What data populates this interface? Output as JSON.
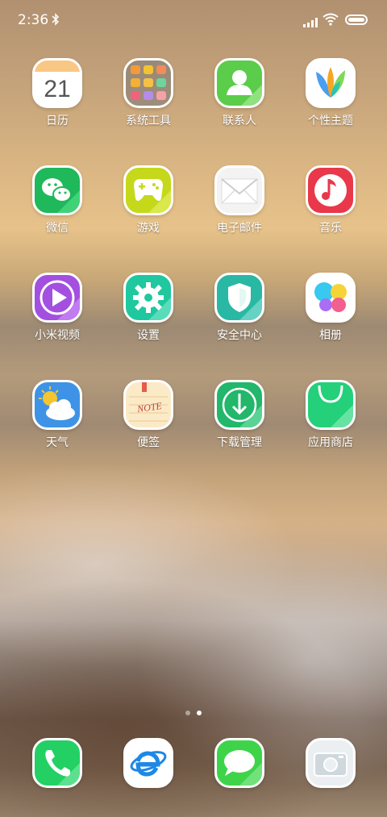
{
  "status": {
    "time": "2:36"
  },
  "grid": [
    {
      "label": "日历",
      "icon": "calendar-icon",
      "badge": "21"
    },
    {
      "label": "系统工具",
      "icon": "system-tools-folder-icon"
    },
    {
      "label": "联系人",
      "icon": "contacts-icon"
    },
    {
      "label": "个性主题",
      "icon": "themes-icon"
    },
    {
      "label": "微信",
      "icon": "wechat-icon"
    },
    {
      "label": "游戏",
      "icon": "gamepad-icon"
    },
    {
      "label": "电子邮件",
      "icon": "email-icon"
    },
    {
      "label": "音乐",
      "icon": "music-icon"
    },
    {
      "label": "小米视频",
      "icon": "video-play-icon"
    },
    {
      "label": "设置",
      "icon": "gear-icon"
    },
    {
      "label": "安全中心",
      "icon": "shield-icon"
    },
    {
      "label": "相册",
      "icon": "gallery-icon"
    },
    {
      "label": "天气",
      "icon": "weather-icon"
    },
    {
      "label": "便签",
      "icon": "notes-icon",
      "badge": "NOTE"
    },
    {
      "label": "下载管理",
      "icon": "download-icon"
    },
    {
      "label": "应用商店",
      "icon": "app-store-bag-icon"
    }
  ],
  "dock": [
    {
      "icon": "phone-icon"
    },
    {
      "icon": "browser-icon"
    },
    {
      "icon": "messages-icon"
    },
    {
      "icon": "camera-icon"
    }
  ],
  "pager": {
    "pages": 2,
    "active": 2
  }
}
